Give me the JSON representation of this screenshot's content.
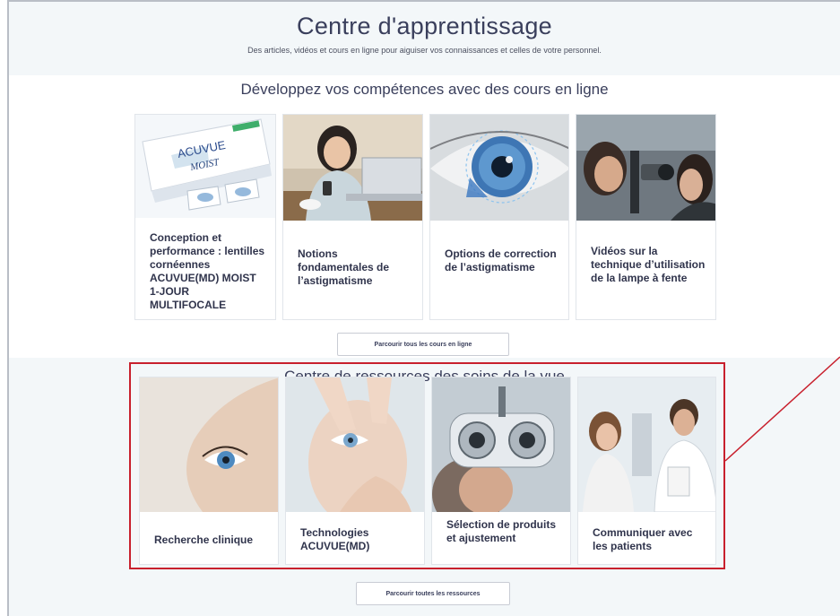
{
  "header": {
    "title": "Centre d'apprentissage",
    "subtitle": "Des articles, vidéos et cours en ligne pour aiguiser vos connaissances et celles de votre personnel."
  },
  "courses": {
    "title": "Développez vos compétences avec des cours en ligne",
    "items": [
      {
        "label": "Conception et performance : lentilles cornéennes ACUVUE(MD) MOIST 1-JOUR MULTIFOCALE",
        "image": "contact-lens-box-image",
        "box_text": "ACUVUE",
        "box_subtext": "MOIST"
      },
      {
        "label": "Notions fondamentales de l’astigmatisme",
        "image": "woman-with-phone-laptop-image"
      },
      {
        "label": "Options de correction de l’astigmatisme",
        "image": "eye-closeup-image"
      },
      {
        "label": "Vidéos sur la technique d’utilisation de la lampe à fente",
        "image": "slit-lamp-exam-image"
      }
    ],
    "button": "Parcourir tous les cours en ligne"
  },
  "resources": {
    "title": "Centre de ressources des soins de la vue",
    "items": [
      {
        "label": "Recherche clinique",
        "image": "eye-profile-image"
      },
      {
        "label": "Technologies ACUVUE(MD)",
        "image": "inserting-contact-lens-image"
      },
      {
        "label": "Sélection de produits et ajustement",
        "image": "phoropter-exam-image"
      },
      {
        "label": "Communiquer avec les patients",
        "image": "doctor-and-patient-image"
      }
    ],
    "button": "Parcourir toutes les ressources"
  },
  "colors": {
    "accent": "#c8202d",
    "section_bg": "#f3f7f9",
    "text": "#30344c"
  }
}
